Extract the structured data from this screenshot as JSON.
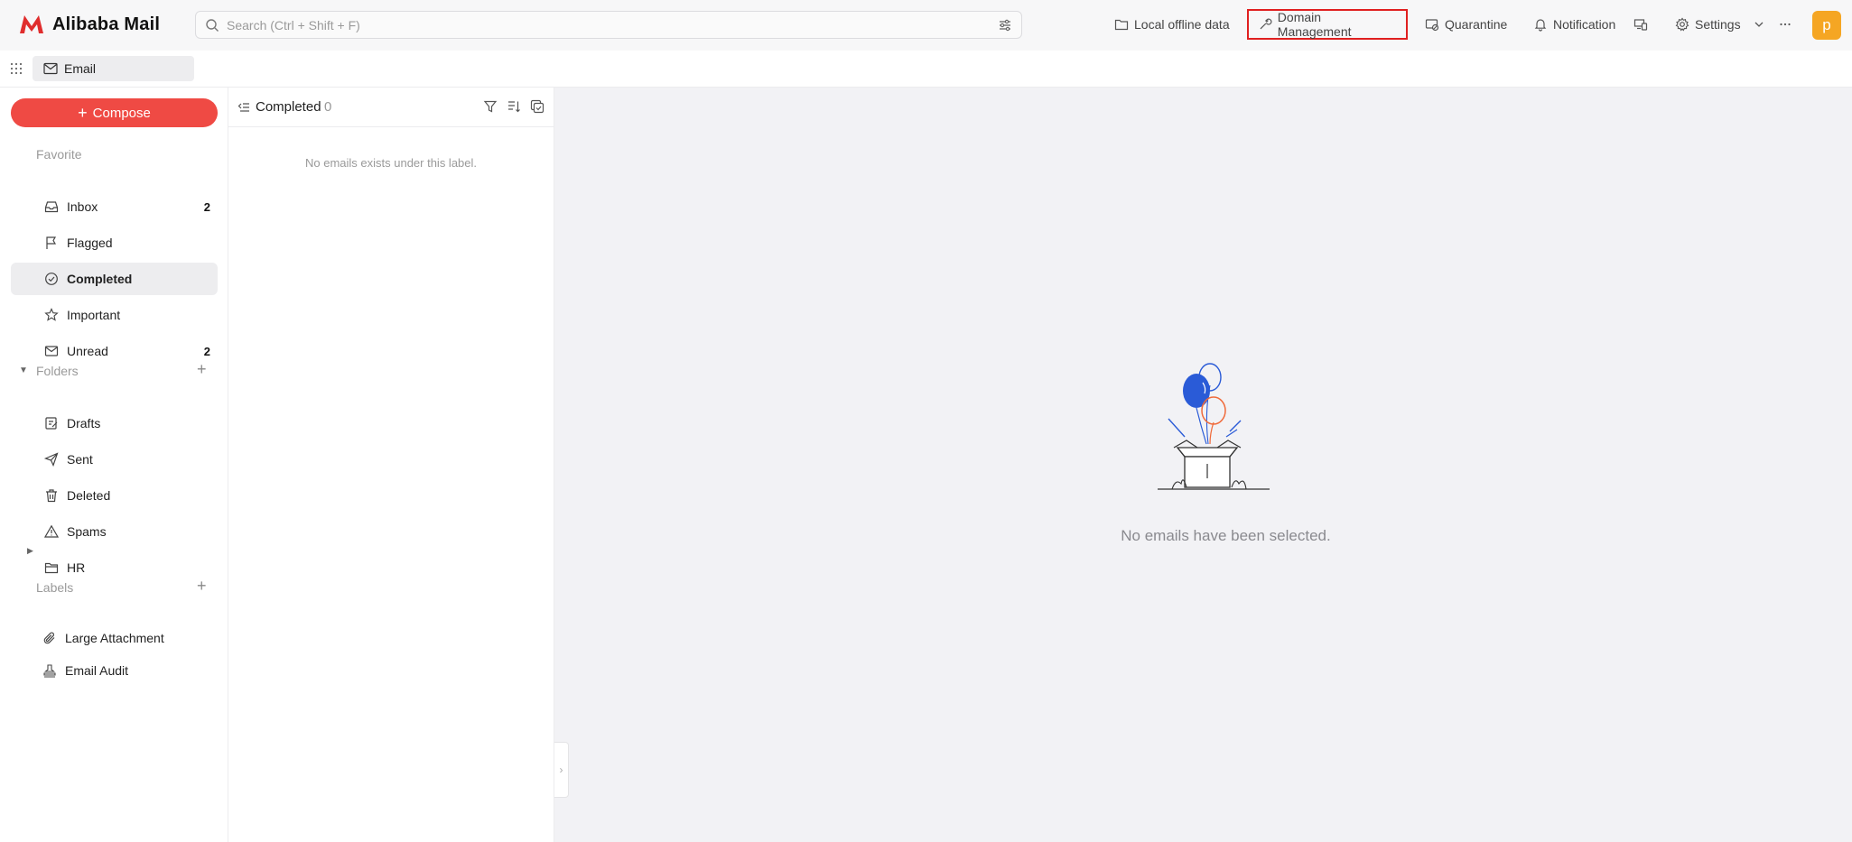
{
  "app": {
    "name": "Alibaba Mail",
    "brand_color": "#e02d2d"
  },
  "search": {
    "placeholder": "Search (Ctrl + Shift + F)"
  },
  "topnav": {
    "local_offline": "Local offline data",
    "domain_management": "Domain Management",
    "quarantine": "Quarantine",
    "notification": "Notification",
    "settings": "Settings",
    "avatar_letter": "p"
  },
  "subbar": {
    "tab_label": "Email"
  },
  "sidebar": {
    "compose": "Compose",
    "favorite_header": "Favorite",
    "favorites": [
      {
        "label": "Inbox",
        "count": "2"
      },
      {
        "label": "Flagged",
        "count": ""
      },
      {
        "label": "Completed",
        "count": ""
      },
      {
        "label": "Important",
        "count": ""
      },
      {
        "label": "Unread",
        "count": "2"
      }
    ],
    "folders_header": "Folders",
    "folders": [
      {
        "label": "Drafts"
      },
      {
        "label": "Sent"
      },
      {
        "label": "Deleted"
      },
      {
        "label": "Spams"
      },
      {
        "label": "HR"
      }
    ],
    "labels_header": "Labels",
    "labels": [
      {
        "label": "Large Attachment"
      },
      {
        "label": "Email Audit"
      }
    ]
  },
  "list": {
    "title": "Completed",
    "count": "0",
    "empty_text": "No emails exists under this label."
  },
  "preview": {
    "empty_text": "No emails have been selected."
  },
  "colors": {
    "accent": "#ef4a44",
    "avatar": "#f5a623",
    "highlight_border": "#e02020",
    "balloon_blue": "#2a5bd7",
    "balloon_orange": "#f06a3a"
  }
}
